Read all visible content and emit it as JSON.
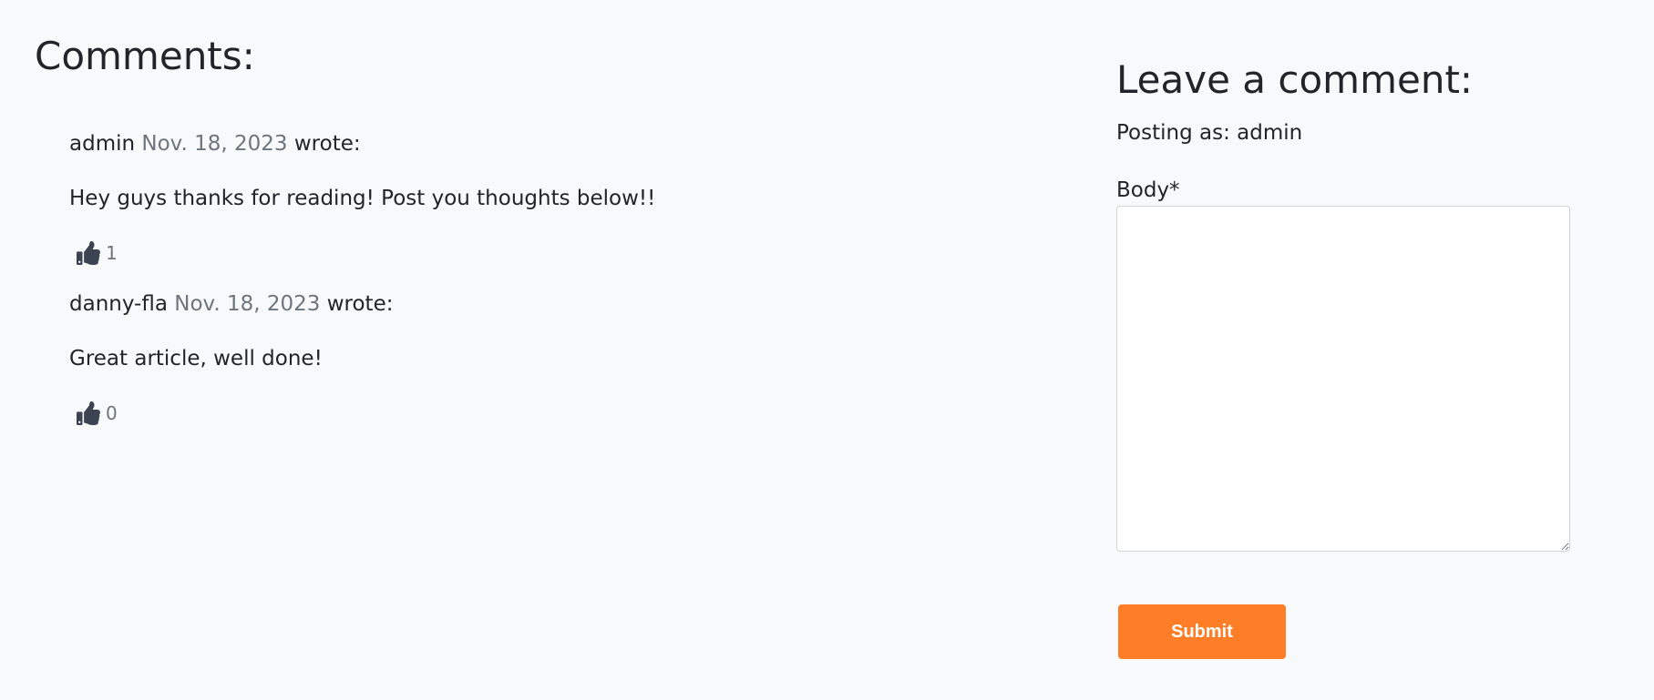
{
  "comments_section": {
    "title": "Comments:",
    "items": [
      {
        "author": "admin",
        "date": "Nov. 18, 2023",
        "wrote": "wrote:",
        "body": "Hey guys thanks for reading! Post you thoughts below!!",
        "likes": "1"
      },
      {
        "author": "danny-fla",
        "date": "Nov. 18, 2023",
        "wrote": "wrote:",
        "body": "Great article, well done!",
        "likes": "0"
      }
    ]
  },
  "comment_form": {
    "title": "Leave a comment:",
    "posting_as": "Posting as: admin",
    "body_label": "Body*",
    "body_value": "",
    "submit_label": "Submit"
  },
  "colors": {
    "background": "#f8f9fa",
    "text": "#212529",
    "muted": "#6c757d",
    "icon": "#3d4451",
    "accent": "#fd7e26"
  },
  "icons": {
    "like": "thumbs-up-icon"
  }
}
